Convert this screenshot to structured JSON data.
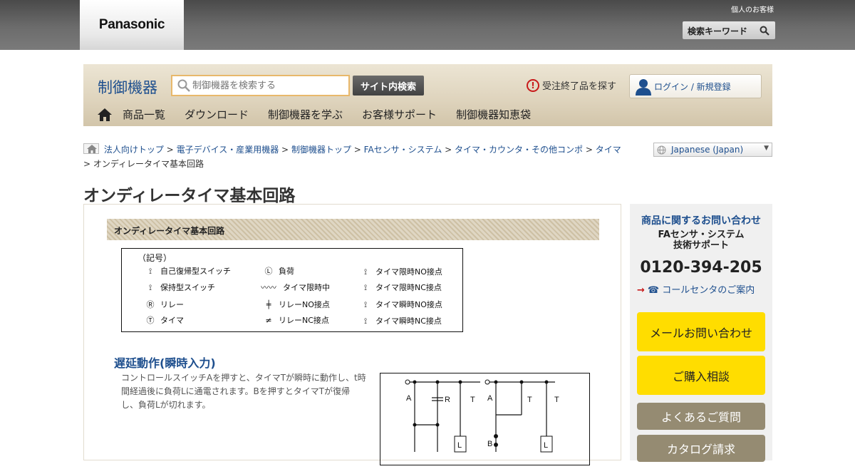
{
  "global_header": {
    "logo": "Panasonic",
    "personal_link": "個人のお客様",
    "keyword_button": "検索キーワード"
  },
  "sub_header": {
    "brand": "制御機器",
    "search_placeholder": "制御機器を検索する",
    "search_button": "サイト内検索",
    "discontinued_link": "受注終了品を探す",
    "login_link": "ログイン / 新規登録",
    "nav": [
      "商品一覧",
      "ダウンロード",
      "制御機器を学ぶ",
      "お客様サポート",
      "制御機器知恵袋"
    ]
  },
  "breadcrumb": {
    "links": [
      "法人向けトップ",
      "電子デバイス・産業用機器",
      "制御機器トップ",
      "FAセンサ・システム",
      "タイマ・カウンタ・その他コンポ",
      "タイマ"
    ],
    "separator": ">",
    "current": "オンディレータイマ基本回路"
  },
  "language": "Japanese (Japan)",
  "page_title": "オンディレータイマ基本回路",
  "section": {
    "header": "オンディレータイマ基本回路",
    "symbols_title": "（記号）",
    "symbols": [
      [
        "自己復帰型スイッチ",
        "負荷",
        "タイマ限時NO接点"
      ],
      [
        "保持型スイッチ",
        "タイマ限時中",
        "タイマ限時NC接点"
      ],
      [
        "リレー",
        "リレーNO接点",
        "タイマ瞬時NO接点"
      ],
      [
        "タイマ",
        "リレーNC接点",
        "タイマ瞬時NC接点"
      ]
    ],
    "symbol_letters": {
      "load": "L",
      "relay": "R",
      "timer": "T"
    },
    "subsection_title": "遅延動作(瞬時入力)",
    "description": "コントロールスイッチAを押すと、タイマTが瞬時に動作し、t時間経過後に負荷Lに通電されます。Bを押すとタイマTが復帰し、負荷Lが切れます。",
    "circuit_labels": [
      "A",
      "R",
      "T",
      "A",
      "T",
      "T",
      "L",
      "B",
      "L"
    ]
  },
  "sidebar": {
    "inquiry_title": "商品に関するお問い合わせ",
    "support_line1": "FAセンサ・システム",
    "support_line2": "技術サポート",
    "phone": "0120-394-205",
    "call_center": "コールセンタのご案内",
    "buttons": [
      "メールお問い合わせ",
      "ご購入相談",
      "よくあるご質問",
      "カタログ請求"
    ]
  },
  "colors": {
    "accent_blue": "#1e4f8e",
    "yellow_button": "#ffdd00",
    "gray_button": "#958b72",
    "alert_red": "#c8191a"
  }
}
